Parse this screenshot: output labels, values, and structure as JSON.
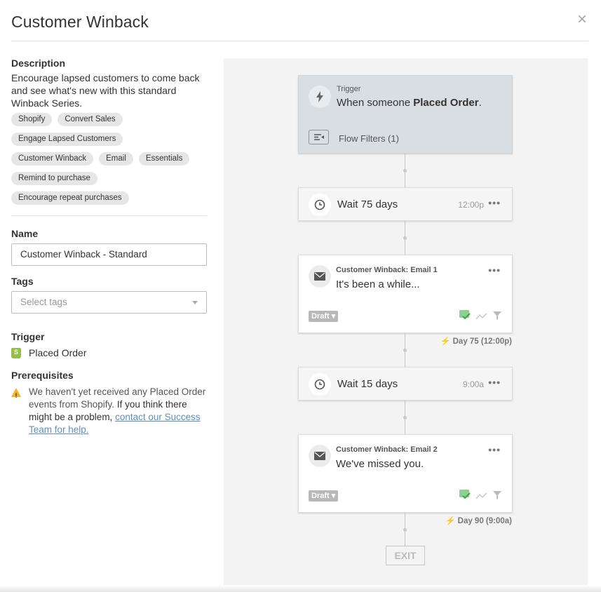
{
  "header": {
    "title": "Customer Winback",
    "close_icon": "close-icon"
  },
  "sidebar": {
    "description_label": "Description",
    "description": "Encourage lapsed customers to come back and see what's new with this standard Winback Series.",
    "chips": [
      "Shopify",
      "Convert Sales",
      "Engage Lapsed Customers",
      "Customer Winback",
      "Email",
      "Essentials",
      "Remind to purchase",
      "Encourage repeat purchases"
    ],
    "name_label": "Name",
    "name_value": "Customer Winback - Standard",
    "tags_label": "Tags",
    "tags_placeholder": "Select tags",
    "trigger_label": "Trigger",
    "trigger_value": "Placed Order",
    "prereq_label": "Prerequisites",
    "prereq_text": "We haven't yet received any Placed Order events from Shopify.",
    "prereq_text2": " If you think there might be a problem, ",
    "prereq_link": "contact our Success Team for help."
  },
  "flow": {
    "trigger": {
      "label": "Trigger",
      "prefix": "When someone ",
      "event": "Placed Order",
      "suffix": ".",
      "filters": "Flow Filters (1)"
    },
    "wait1": {
      "text": "Wait 75 days",
      "time": "12:00p"
    },
    "email1": {
      "name": "Customer Winback: Email 1",
      "subject": "It's been a while...",
      "status": "Draft",
      "day": "Day 75 (12:00p)"
    },
    "wait2": {
      "text": "Wait 15 days",
      "time": "9:00a"
    },
    "email2": {
      "name": "Customer Winback: Email 2",
      "subject": "We've missed you.",
      "status": "Draft",
      "day": "Day 90 (9:00a)"
    },
    "exit": "EXIT",
    "more": "•••"
  },
  "colors": {
    "shopify": "#95bf47",
    "warning": "#f0b429",
    "link": "#5a8fc4",
    "trigger_bg": "#d9dee3",
    "success": "#5cb85c"
  }
}
